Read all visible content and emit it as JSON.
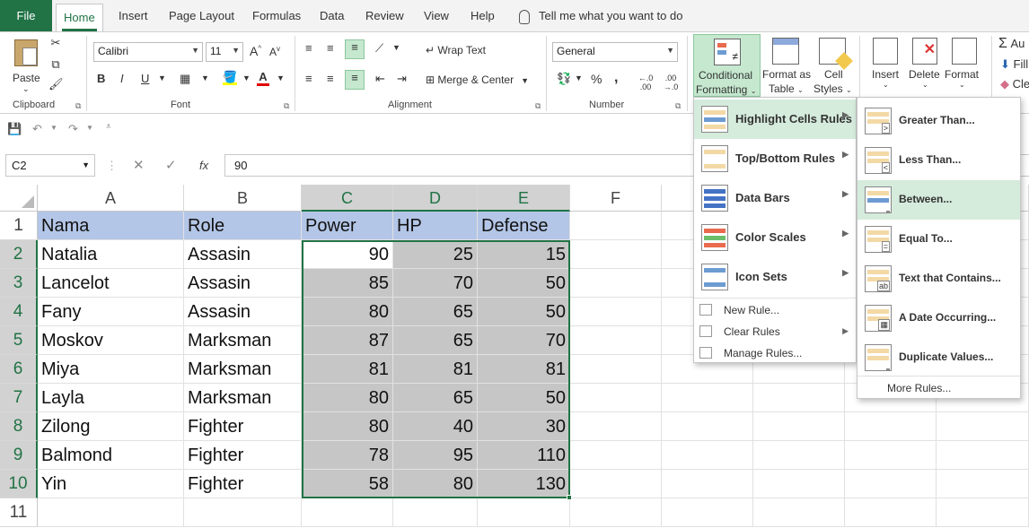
{
  "tabs": {
    "file": "File",
    "home": "Home",
    "insert": "Insert",
    "page_layout": "Page Layout",
    "formulas": "Formulas",
    "data": "Data",
    "review": "Review",
    "view": "View",
    "help": "Help",
    "tell_me": "Tell me what you want to do"
  },
  "ribbon": {
    "clipboard": {
      "label": "Clipboard",
      "paste": "Paste"
    },
    "font": {
      "label": "Font",
      "name": "Calibri",
      "size": "11",
      "bold": "B",
      "italic": "I",
      "underline": "U",
      "grow": "A",
      "shrink": "A"
    },
    "alignment": {
      "label": "Alignment",
      "wrap": "Wrap Text",
      "merge": "Merge & Center"
    },
    "number": {
      "label": "Number",
      "format": "General",
      "percent": "%",
      "comma": ",",
      "inc": "←.0 .00",
      "dec": ".00 →.0"
    },
    "styles": {
      "cf_line1": "Conditional",
      "cf_line2": "Formatting",
      "fat_line1": "Format as",
      "fat_line2": "Table",
      "cs_line1": "Cell",
      "cs_line2": "Styles"
    },
    "cells": {
      "insert": "Insert",
      "delete": "Delete",
      "format": "Format"
    },
    "editing": {
      "autosum": "Au",
      "fill": "Fill",
      "clear": "Cle"
    }
  },
  "namebox": "C2",
  "fx": "fx",
  "formula": "90",
  "columns": [
    "A",
    "B",
    "C",
    "D",
    "E",
    "F"
  ],
  "rows": [
    "1",
    "2",
    "3",
    "4",
    "5",
    "6",
    "7",
    "8",
    "9",
    "10",
    "11"
  ],
  "table": {
    "header": [
      "Nama",
      "Role",
      "Power",
      "HP",
      "Defense"
    ],
    "data": [
      [
        "Natalia",
        "Assasin",
        "90",
        "25",
        "15"
      ],
      [
        "Lancelot",
        "Assasin",
        "85",
        "70",
        "50"
      ],
      [
        "Fany",
        "Assasin",
        "80",
        "65",
        "50"
      ],
      [
        "Moskov",
        "Marksman",
        "87",
        "65",
        "70"
      ],
      [
        "Miya",
        "Marksman",
        "81",
        "81",
        "81"
      ],
      [
        "Layla",
        "Marksman",
        "80",
        "65",
        "50"
      ],
      [
        "Zilong",
        "Fighter",
        "80",
        "40",
        "30"
      ],
      [
        "Balmond",
        "Fighter",
        "78",
        "95",
        "110"
      ],
      [
        "Yin",
        "Fighter",
        "58",
        "80",
        "130"
      ]
    ]
  },
  "cf_menu": {
    "items": [
      "Highlight Cells Rules",
      "Top/Bottom Rules",
      "Data Bars",
      "Color Scales",
      "Icon Sets"
    ],
    "small": [
      "New Rule...",
      "Clear Rules",
      "Manage Rules..."
    ]
  },
  "sub_menu": {
    "items": [
      "Greater Than...",
      "Less Than...",
      "Between...",
      "Equal To...",
      "Text that Contains...",
      "A Date Occurring...",
      "Duplicate Values..."
    ],
    "more": "More Rules..."
  },
  "colors": {
    "accent": "#217346",
    "header_fill": "#b4c6e7",
    "selection_fill": "#c6c6c6",
    "menu_highlight": "#d5ebdc"
  }
}
